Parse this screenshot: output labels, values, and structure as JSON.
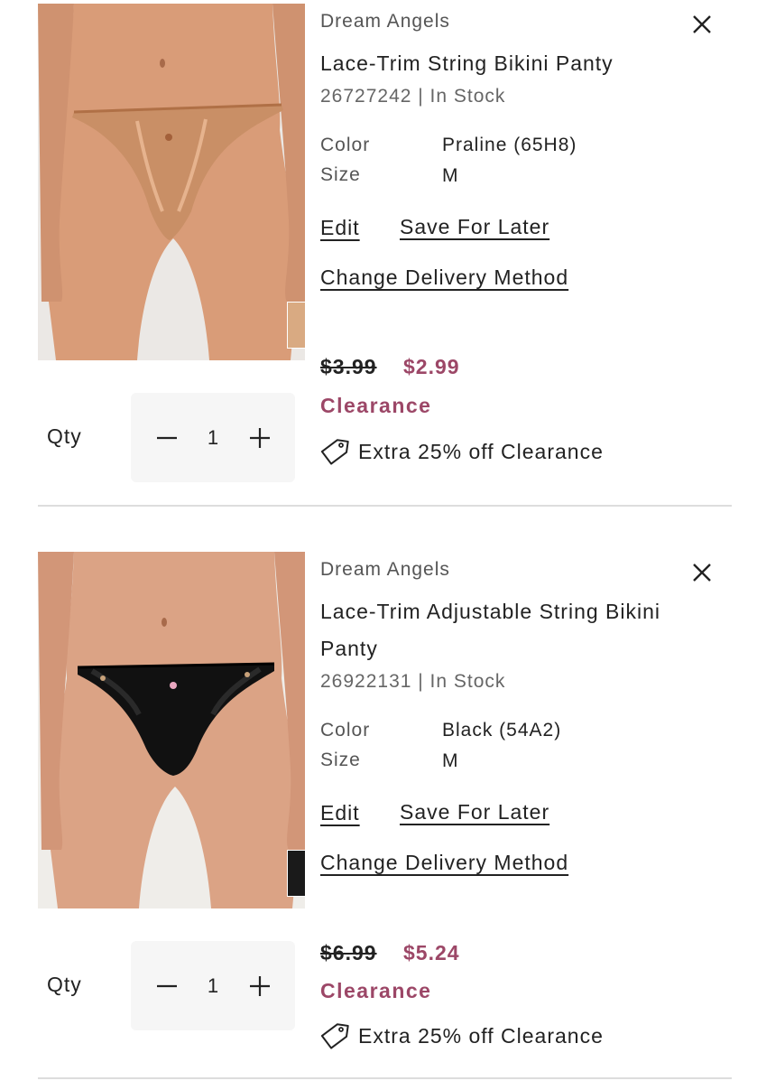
{
  "cart": {
    "items": [
      {
        "brand": "Dream Angels",
        "name": "Lace-Trim String Bikini Panty",
        "stock": "26727242 | In Stock",
        "color_label": "Color",
        "color_value": "Praline (65H8)",
        "size_label": "Size",
        "size_value": "M",
        "edit_label": "Edit",
        "save_later_label": "Save For Later",
        "delivery_label": "Change Delivery Method",
        "price_original": "$3.99",
        "price_sale": "$2.99",
        "badge": "Clearance",
        "promo": "Extra 25% off Clearance",
        "qty_label": "Qty",
        "qty": "1",
        "swatch_color": "#d9aa82",
        "garment_color": "#c98f66",
        "icons": [
          "close-icon",
          "minus-icon",
          "plus-icon",
          "price-tag-icon"
        ]
      },
      {
        "brand": "Dream Angels",
        "name": "Lace-Trim Adjustable String Bikini Panty",
        "stock": "26922131 | In Stock",
        "color_label": "Color",
        "color_value": "Black (54A2)",
        "size_label": "Size",
        "size_value": "M",
        "edit_label": "Edit",
        "save_later_label": "Save For Later",
        "delivery_label": "Change Delivery Method",
        "price_original": "$6.99",
        "price_sale": "$5.24",
        "badge": "Clearance",
        "promo": "Extra 25% off Clearance",
        "qty_label": "Qty",
        "qty": "1",
        "swatch_color": "#1a1a1a",
        "garment_color": "#111111",
        "icons": [
          "close-icon",
          "minus-icon",
          "plus-icon",
          "price-tag-icon"
        ]
      }
    ]
  },
  "colors": {
    "sale_accent": "#9c4767",
    "stepper_bg": "#f6f6f6",
    "divider": "#dddddd"
  }
}
